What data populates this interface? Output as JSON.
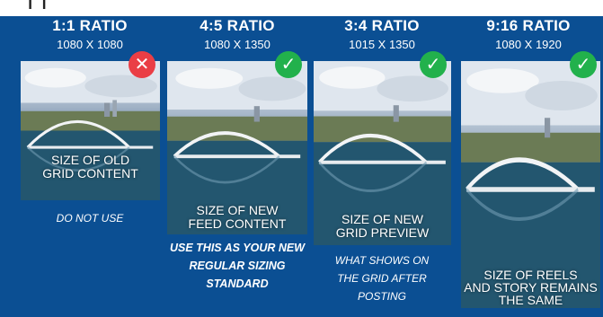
{
  "colors": {
    "background": "#0b4f93",
    "reject": "#ea3e45",
    "accept": "#22b14c"
  },
  "header": {
    "cut_text": "I                   I"
  },
  "cards": [
    {
      "ratio": "1:1 RATIO",
      "dims": "1080 X 1080",
      "status": "reject",
      "status_icon": "x-icon",
      "caption_lines": [
        "SIZE OF OLD",
        "GRID CONTENT"
      ],
      "note_lines": [
        "DO NOT USE"
      ]
    },
    {
      "ratio": "4:5 RATIO",
      "dims": "1080 X 1350",
      "status": "accept",
      "status_icon": "check-icon",
      "caption_lines": [
        "SIZE OF NEW",
        "FEED CONTENT"
      ],
      "note_lines": [
        "USE THIS AS YOUR NEW",
        "REGULAR SIZING",
        "STANDARD"
      ]
    },
    {
      "ratio": "3:4 RATIO",
      "dims": "1015 X 1350",
      "status": "accept",
      "status_icon": "check-icon",
      "caption_lines": [
        "SIZE OF NEW",
        "GRID PREVIEW"
      ],
      "note_lines": [
        "WHAT SHOWS ON",
        "THE GRID AFTER",
        "POSTING"
      ]
    },
    {
      "ratio": "9:16 RATIO",
      "dims": "1080 X 1920",
      "status": "accept",
      "status_icon": "check-icon",
      "caption_lines": [
        "SIZE OF REELS",
        "AND STORY REMAINS",
        "THE SAME"
      ],
      "note_lines": []
    }
  ]
}
